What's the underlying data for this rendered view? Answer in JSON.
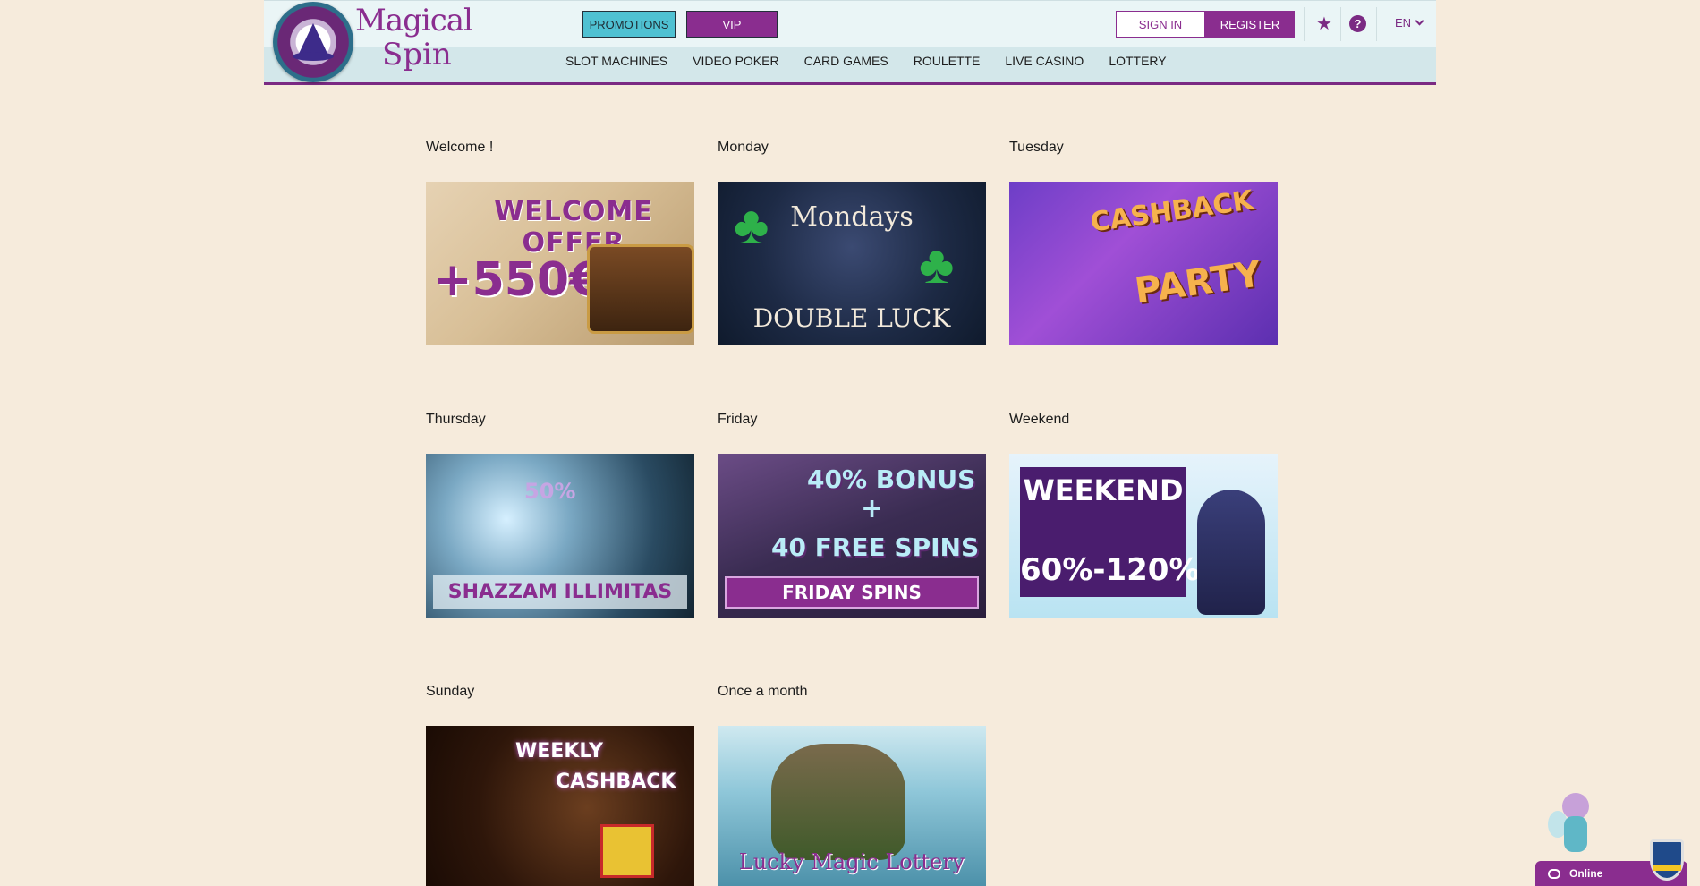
{
  "brand": {
    "name_line1": "Magical",
    "name_line2": "Spin",
    "accent_color": "#8a2d8f",
    "promo_color": "#4fc1d2"
  },
  "header": {
    "promotions_label": "PROMOTIONS",
    "vip_label": "VIP",
    "signin_label": "SIGN IN",
    "register_label": "REGISTER",
    "favorites_icon": "star-icon",
    "help_icon": "help-icon",
    "help_glyph": "?",
    "language": "EN"
  },
  "nav": {
    "items": [
      {
        "label": "SLOT MACHINES"
      },
      {
        "label": "VIDEO POKER"
      },
      {
        "label": "CARD GAMES"
      },
      {
        "label": "ROULETTE"
      },
      {
        "label": "LIVE CASINO"
      },
      {
        "label": "LOTTERY"
      }
    ]
  },
  "promotions": [
    {
      "title": "Welcome !",
      "banner_text": [
        "WELCOME OFFER",
        "+550€"
      ]
    },
    {
      "title": "Monday",
      "banner_text": [
        "Mondays",
        "DOUBLE LUCK"
      ]
    },
    {
      "title": "Tuesday",
      "banner_text": [
        "CASHBACK",
        "PARTY"
      ]
    },
    {
      "title": "Thursday",
      "banner_text": [
        "50%",
        "SHAZZAM ILLIMITAS"
      ]
    },
    {
      "title": "Friday",
      "banner_text": [
        "40% BONUS",
        "+",
        "40 FREE SPINS",
        "FRIDAY SPINS"
      ]
    },
    {
      "title": "Weekend",
      "banner_text": [
        "WEEKEND",
        "60%-120%"
      ]
    },
    {
      "title": "Sunday",
      "banner_text": [
        "WEEKLY",
        "CASHBACK"
      ]
    },
    {
      "title": "Once a month",
      "banner_text": [
        "Lucky Magic Lottery"
      ]
    }
  ],
  "chat_widget": {
    "status_label": "Online"
  }
}
